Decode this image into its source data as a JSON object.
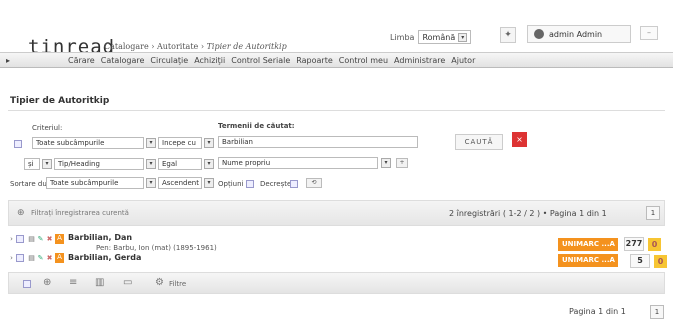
{
  "header": {
    "logo": "tinread",
    "breadcrumb": {
      "part1": "Catalogare",
      "sep1": " › ",
      "part2": "Autoritate",
      "sep2": " › ",
      "current": "Tipier de Autoritkip"
    },
    "language_label": "Limba",
    "language_value": "Română",
    "user_label": "admin Admin"
  },
  "menu": [
    "Cărare",
    "Catalogare",
    "Circulaţie",
    "Achiziţii",
    "Control Seriale",
    "Rapoarte",
    "Control meu",
    "Administrare",
    "Ajutor"
  ],
  "page_title": "Tipier de Autoritkip",
  "search": {
    "criteria_label": "Criteriul:",
    "terms_label": "Termenii de căutat:",
    "field1": "Toate subcâmpurile",
    "operator1": "Incepe cu",
    "term1": "Barbilian",
    "logic": "și",
    "field2": "Tip/Heading",
    "operator2": "Egal",
    "term2": "Nume propriu",
    "sort_label": "Sortare după",
    "sort_field": "Toate subcâmpurile",
    "sort_order": "Ascendent",
    "opt1": "Opțiuni",
    "opt2": "Decrește",
    "search_button": "CAUTĂ",
    "clear_button": "×"
  },
  "results": {
    "select_label": "Filtrați înregistrarea curentă",
    "summary": "2 înregistrări ( 1-2 / 2 ) • Pagina 1 din 1",
    "page_btn": "1",
    "rows": [
      {
        "title": "Barbilian, Dan",
        "subtitle": "Pen: Barbu, Ion (mat) (1895-1961)",
        "badge": "UNIMARC ...A",
        "count": "277",
        "flag": "0"
      },
      {
        "title": "Barbilian, Gerda",
        "subtitle": "",
        "badge": "UNIMARC ...A",
        "count": "5",
        "flag": "0"
      }
    ],
    "toolbar_filter": "Filtre",
    "bottom_pager": "Pagina 1 din 1",
    "bottom_page_btn": "1"
  }
}
